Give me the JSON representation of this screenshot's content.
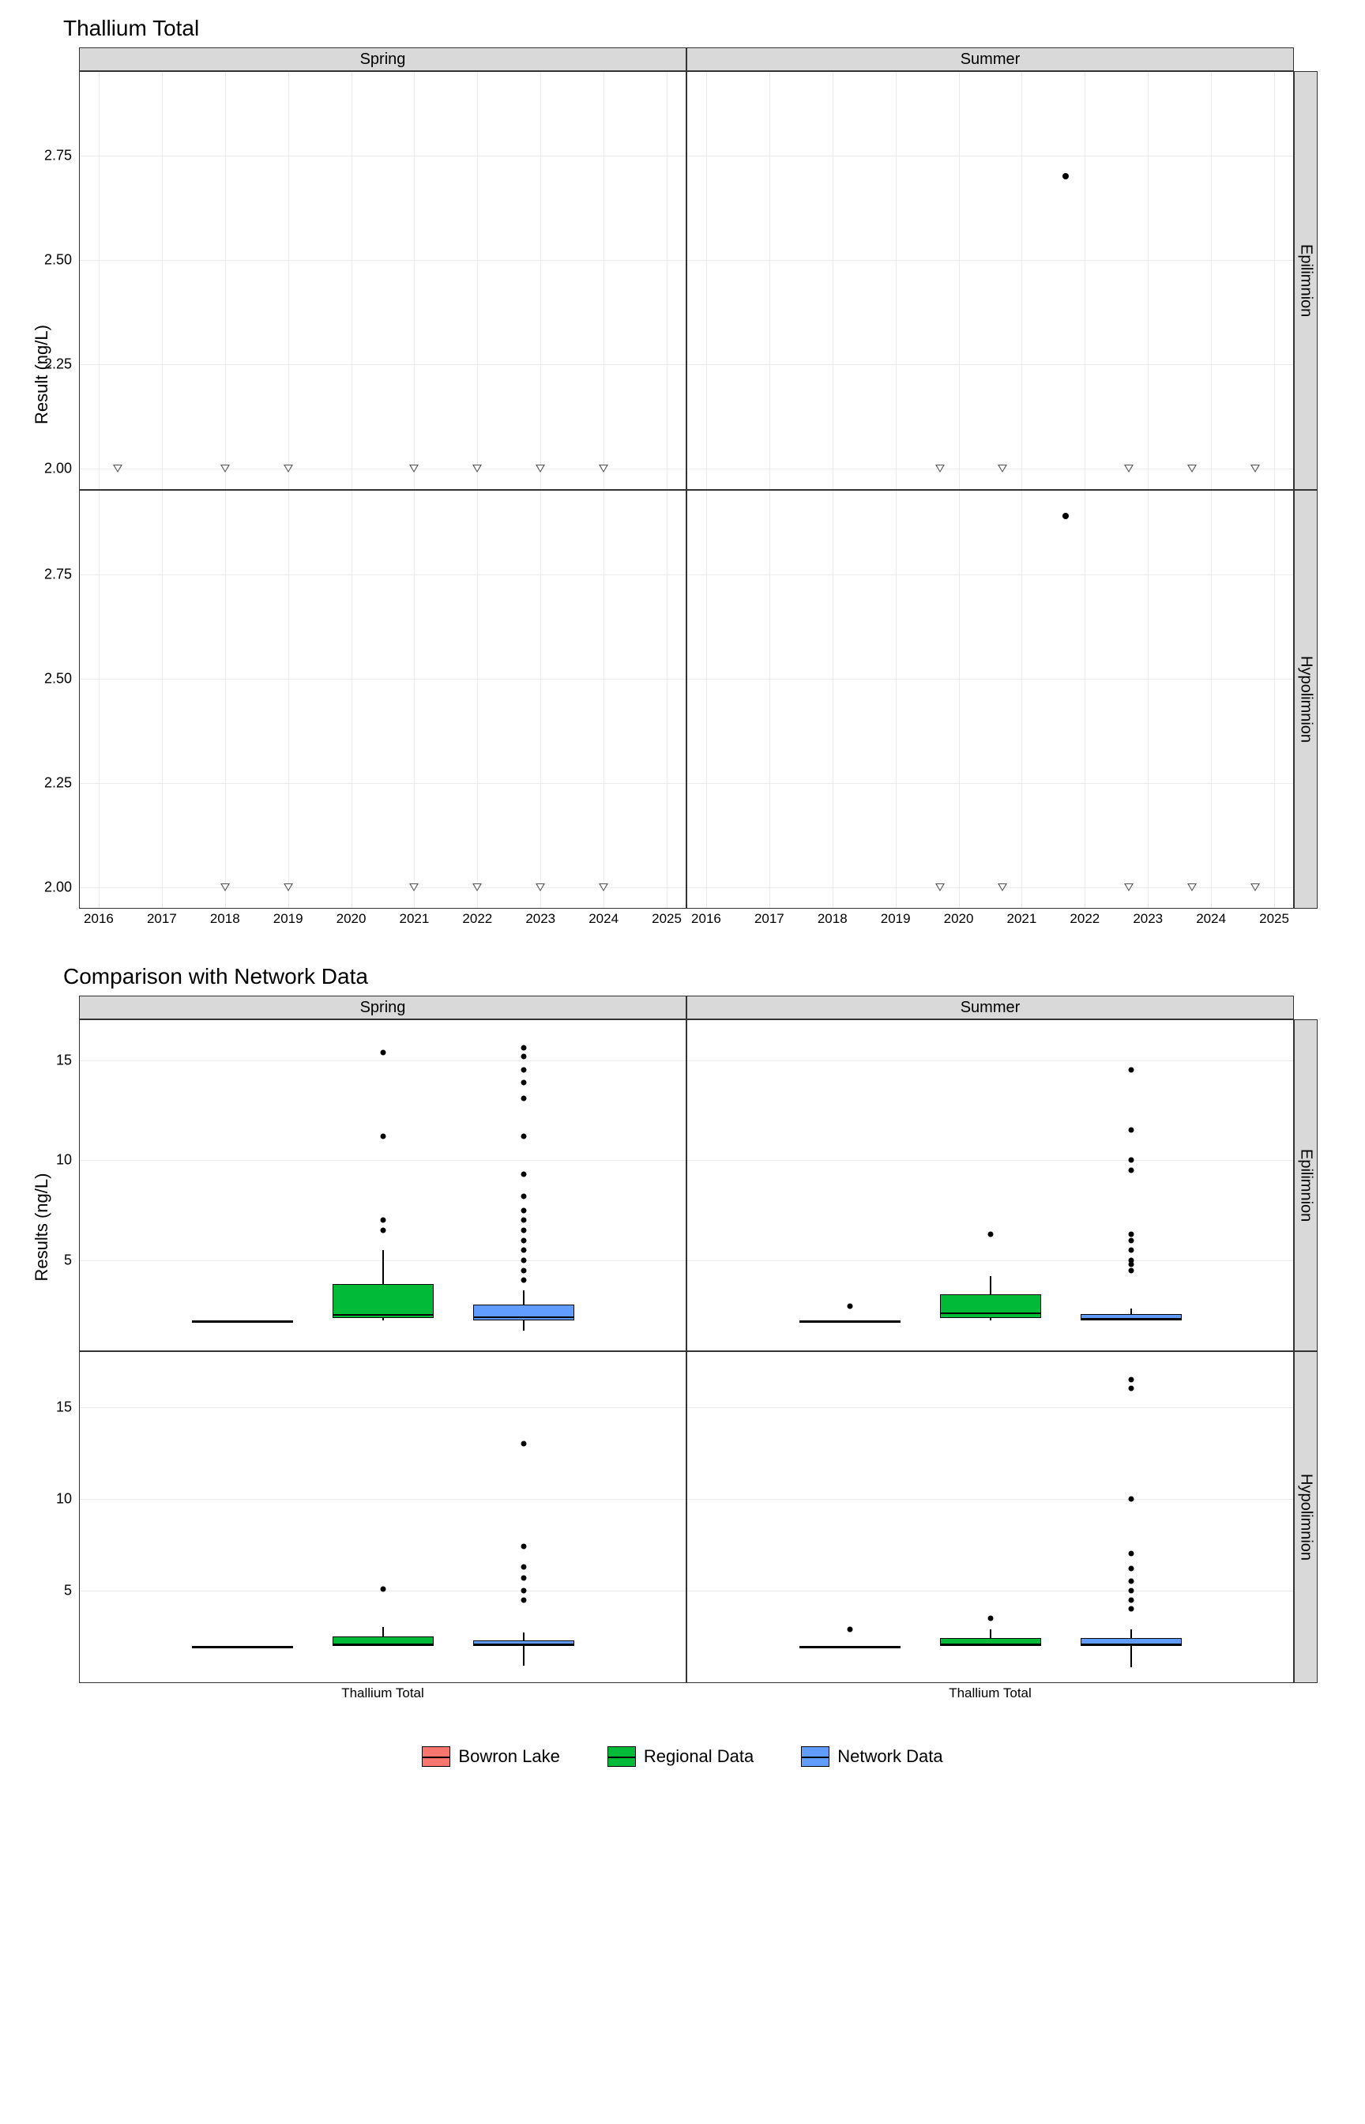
{
  "chart_data": [
    {
      "id": "top",
      "type": "scatter",
      "title": "Thallium Total",
      "ylabel": "Result (ng/L)",
      "x_ticks": [
        2016,
        2017,
        2018,
        2019,
        2020,
        2021,
        2022,
        2023,
        2024,
        2025
      ],
      "y_ticks_epi": [
        2.0,
        2.25,
        2.5,
        2.75
      ],
      "y_ticks_hypo": [
        2.0,
        2.25,
        2.5,
        2.75
      ],
      "facets_col": [
        "Spring",
        "Summer"
      ],
      "facets_row": [
        "Epilimnion",
        "Hypolimnion"
      ],
      "series": [
        {
          "panel": "Spring-Epilimnion",
          "type": "censored",
          "points": [
            [
              2016.3,
              2.0
            ],
            [
              2018,
              2.0
            ],
            [
              2019,
              2.0
            ],
            [
              2021,
              2.0
            ],
            [
              2022,
              2.0
            ],
            [
              2023,
              2.0
            ],
            [
              2024,
              2.0
            ]
          ]
        },
        {
          "panel": "Summer-Epilimnion",
          "type": "censored",
          "points": [
            [
              2019.7,
              2.0
            ],
            [
              2020.7,
              2.0
            ],
            [
              2022.7,
              2.0
            ],
            [
              2023.7,
              2.0
            ],
            [
              2024.7,
              2.0
            ]
          ]
        },
        {
          "panel": "Summer-Epilimnion",
          "type": "detected",
          "points": [
            [
              2021.7,
              2.7
            ]
          ]
        },
        {
          "panel": "Spring-Hypolimnion",
          "type": "censored",
          "points": [
            [
              2018,
              2.0
            ],
            [
              2019,
              2.0
            ],
            [
              2021,
              2.0
            ],
            [
              2022,
              2.0
            ],
            [
              2023,
              2.0
            ],
            [
              2024,
              2.0
            ]
          ]
        },
        {
          "panel": "Summer-Hypolimnion",
          "type": "censored",
          "points": [
            [
              2019.7,
              2.0
            ],
            [
              2020.7,
              2.0
            ],
            [
              2022.7,
              2.0
            ],
            [
              2023.7,
              2.0
            ],
            [
              2024.7,
              2.0
            ]
          ]
        },
        {
          "panel": "Summer-Hypolimnion",
          "type": "detected",
          "points": [
            [
              2021.7,
              2.89
            ]
          ]
        }
      ]
    },
    {
      "id": "bottom",
      "type": "boxplot",
      "title": "Comparison with Network Data",
      "ylabel": "Results (ng/L)",
      "x_category": "Thallium Total",
      "y_ticks_epi": [
        5,
        10,
        15
      ],
      "y_ticks_hypo": [
        5,
        10,
        15
      ],
      "facets_col": [
        "Spring",
        "Summer"
      ],
      "facets_row": [
        "Epilimnion",
        "Hypolimnion"
      ],
      "legend": [
        {
          "name": "Bowron Lake",
          "color": "#f8766d"
        },
        {
          "name": "Regional Data",
          "color": "#00ba38"
        },
        {
          "name": "Network Data",
          "color": "#619cff"
        }
      ],
      "data": {
        "Spring-Epilimnion": [
          {
            "group": "Bowron Lake",
            "min": 2.0,
            "q1": 2.0,
            "median": 2.0,
            "q3": 2.0,
            "max": 2.0,
            "outliers": []
          },
          {
            "group": "Regional Data",
            "min": 2.0,
            "q1": 2.1,
            "median": 2.3,
            "q3": 3.8,
            "max": 5.5,
            "outliers": [
              6.5,
              7.0,
              11.2,
              15.4
            ]
          },
          {
            "group": "Network Data",
            "min": 1.5,
            "q1": 2.0,
            "median": 2.2,
            "q3": 2.8,
            "max": 3.5,
            "outliers": [
              4.0,
              4.5,
              5.0,
              5.5,
              6.0,
              6.5,
              7.0,
              7.5,
              8.2,
              9.3,
              11.2,
              13.1,
              13.9,
              14.5,
              15.2,
              15.6
            ]
          }
        ],
        "Summer-Epilimnion": [
          {
            "group": "Bowron Lake",
            "min": 2.0,
            "q1": 2.0,
            "median": 2.0,
            "q3": 2.0,
            "max": 2.0,
            "outliers": [
              2.7
            ]
          },
          {
            "group": "Regional Data",
            "min": 2.0,
            "q1": 2.1,
            "median": 2.4,
            "q3": 3.3,
            "max": 4.2,
            "outliers": [
              6.3
            ]
          },
          {
            "group": "Network Data",
            "min": 2.0,
            "q1": 2.0,
            "median": 2.1,
            "q3": 2.3,
            "max": 2.6,
            "outliers": [
              4.5,
              4.8,
              5.0,
              5.5,
              6.0,
              6.3,
              9.5,
              10.0,
              11.5,
              14.5
            ]
          }
        ],
        "Spring-Hypolimnion": [
          {
            "group": "Bowron Lake",
            "min": 2.0,
            "q1": 2.0,
            "median": 2.0,
            "q3": 2.0,
            "max": 2.0,
            "outliers": []
          },
          {
            "group": "Regional Data",
            "min": 2.0,
            "q1": 2.0,
            "median": 2.1,
            "q3": 2.5,
            "max": 3.0,
            "outliers": [
              5.1
            ]
          },
          {
            "group": "Network Data",
            "min": 0.9,
            "q1": 2.0,
            "median": 2.1,
            "q3": 2.3,
            "max": 2.7,
            "outliers": [
              4.5,
              5.0,
              5.7,
              6.3,
              7.4,
              13.0
            ]
          }
        ],
        "Summer-Hypolimnion": [
          {
            "group": "Bowron Lake",
            "min": 2.0,
            "q1": 2.0,
            "median": 2.0,
            "q3": 2.0,
            "max": 2.0,
            "outliers": [
              2.9
            ]
          },
          {
            "group": "Regional Data",
            "min": 2.0,
            "q1": 2.0,
            "median": 2.1,
            "q3": 2.4,
            "max": 2.9,
            "outliers": [
              3.5
            ]
          },
          {
            "group": "Network Data",
            "min": 0.8,
            "q1": 2.0,
            "median": 2.1,
            "q3": 2.4,
            "max": 2.9,
            "outliers": [
              4.0,
              4.5,
              5.0,
              5.5,
              6.2,
              7.0,
              10.0,
              16.0,
              16.5
            ]
          }
        ]
      }
    }
  ]
}
